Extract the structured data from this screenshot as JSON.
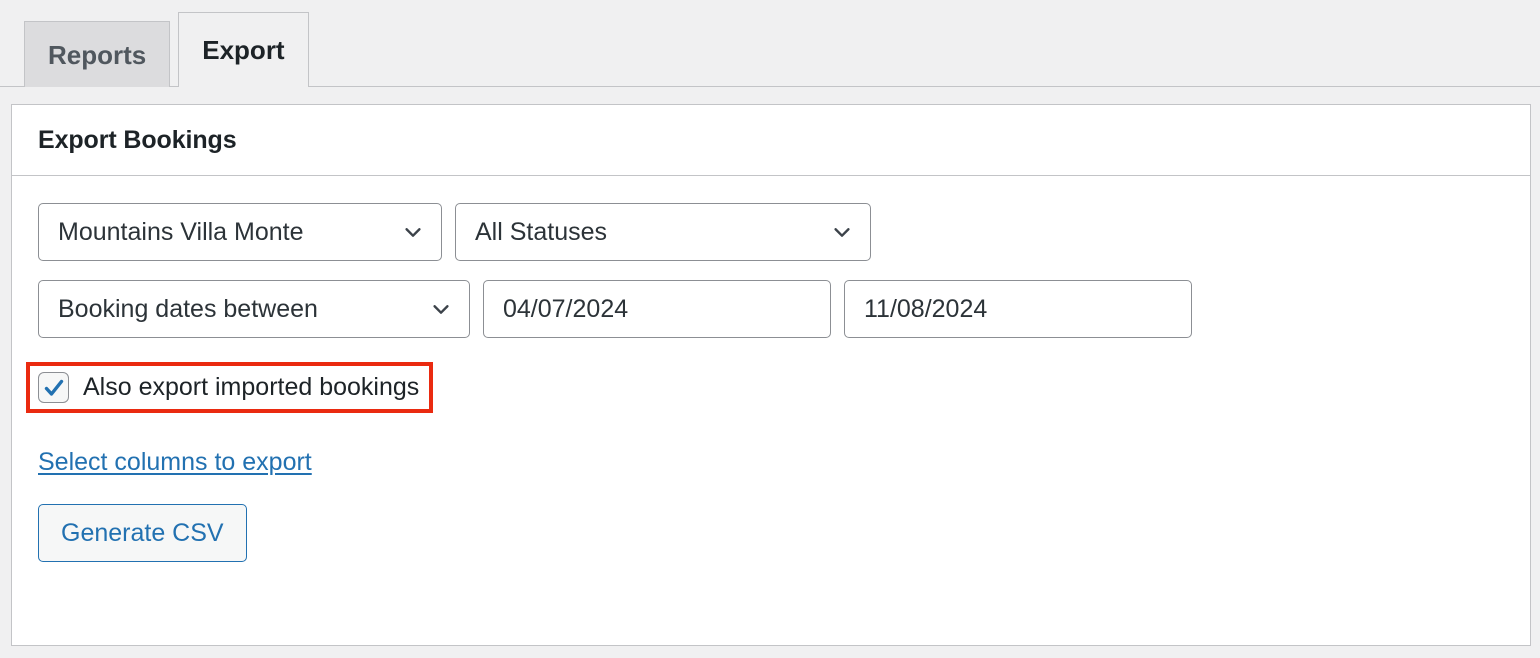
{
  "tabs": [
    {
      "label": "Reports",
      "active": false
    },
    {
      "label": "Export",
      "active": true
    }
  ],
  "panel": {
    "title": "Export Bookings"
  },
  "form": {
    "property_select": {
      "value": "Mountains Villa Monte",
      "icon": "chevron-down-icon"
    },
    "status_select": {
      "value": "All Statuses",
      "icon": "chevron-down-icon"
    },
    "date_mode_select": {
      "value": "Booking dates between",
      "icon": "chevron-down-icon"
    },
    "date_from": {
      "value": "04/07/2024",
      "placeholder": "dd/mm/yyyy"
    },
    "date_to": {
      "value": "11/08/2024",
      "placeholder": "dd/mm/yyyy"
    },
    "imported_checkbox": {
      "label": "Also export imported bookings",
      "checked": true,
      "highlighted": true
    },
    "columns_link": {
      "label": "Select columns to export"
    },
    "generate_button": {
      "label": "Generate CSV"
    }
  },
  "colors": {
    "page_background": "#f0f0f1",
    "panel_background": "#ffffff",
    "border": "#c3c4c7",
    "input_border": "#8c8f94",
    "text": "#1d2327",
    "link": "#2271b1",
    "accent_blue": "#2271b1",
    "checkbox_check": "#2271b1",
    "annotation_red": "#ea2a10",
    "tab_inactive_background": "#dcdcde",
    "tab_inactive_text": "#50575e"
  }
}
